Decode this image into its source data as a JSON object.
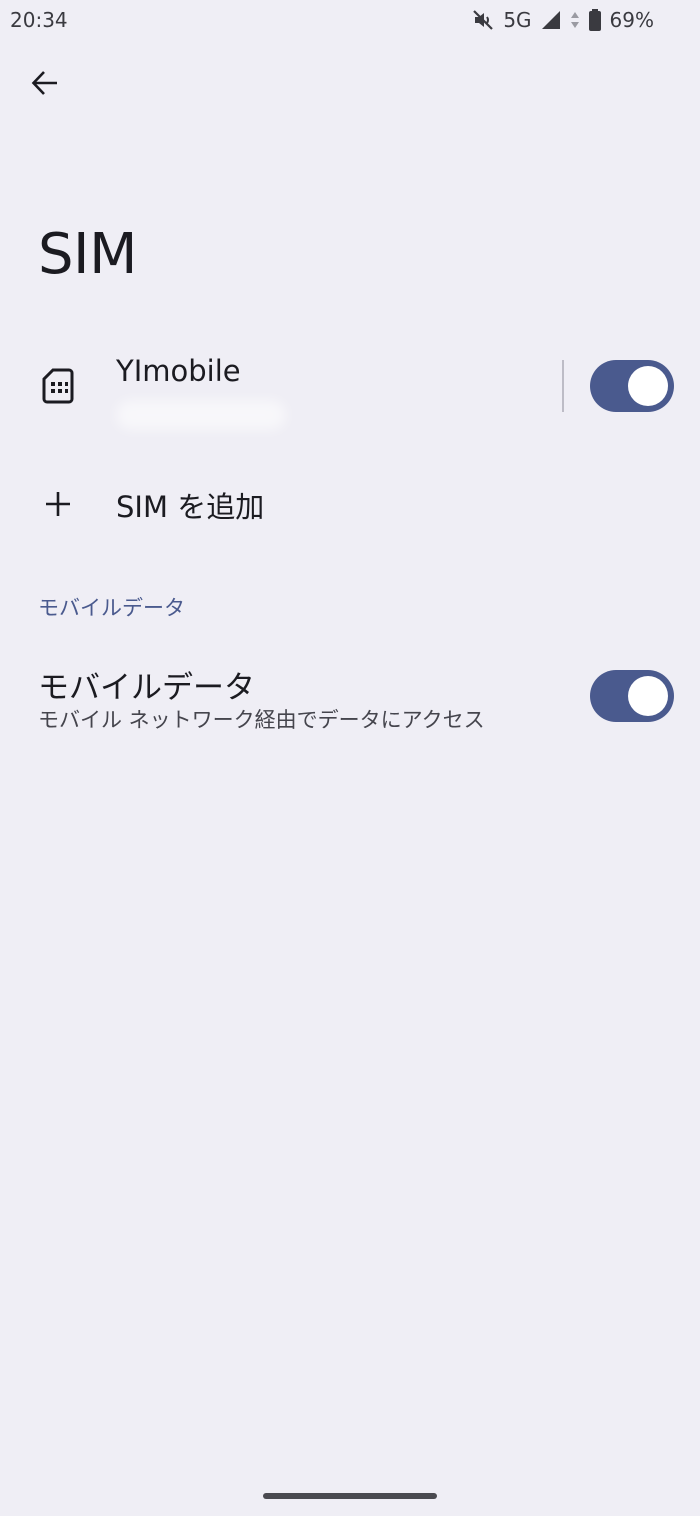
{
  "status_bar": {
    "time": "20:34",
    "network": "5G",
    "battery": "69%",
    "icons": [
      "mute-icon",
      "signal-icon",
      "data-arrows-icon",
      "battery-icon"
    ]
  },
  "header": {
    "title": "SIM"
  },
  "sim_entry": {
    "name": "YImobile",
    "enabled": true
  },
  "add_sim": {
    "label": "SIM を追加"
  },
  "section": {
    "mobile_data_header": "モバイルデータ"
  },
  "mobile_data": {
    "title": "モバイルデータ",
    "subtitle": "モバイル ネットワーク経由でデータにアクセス",
    "enabled": true
  },
  "colors": {
    "background": "#EFEEF5",
    "accent": "#4A5A8E",
    "text": "#1B1B21"
  }
}
